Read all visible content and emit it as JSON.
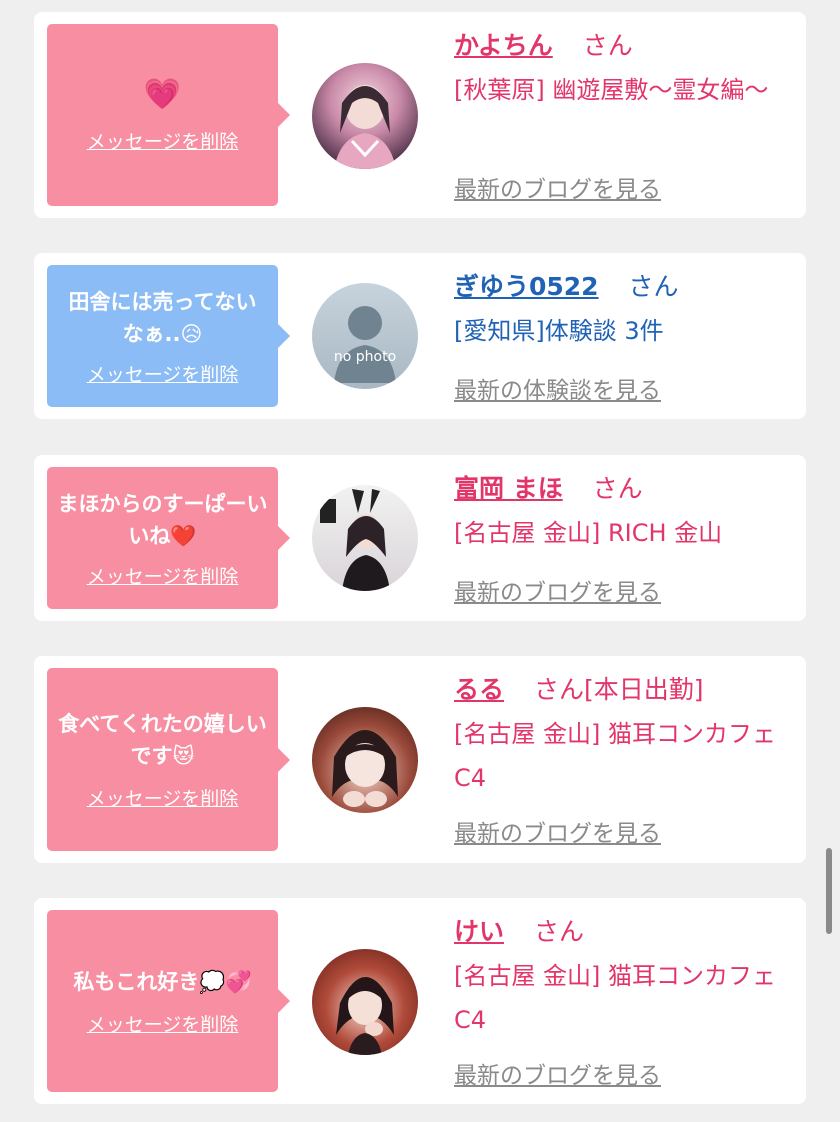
{
  "delete_label": "メッセージを削除",
  "honorific": "さん",
  "entries": [
    {
      "message": "💗",
      "name": "かよちん",
      "status": "",
      "shop": "[秋葉原] 幽遊屋敷～霊女編～",
      "more_link": "最新のブログを見る",
      "bubble_color": "#f88ea2",
      "name_color": "#e2366a"
    },
    {
      "message": "田舎には売ってないなぁ..😥",
      "name": "ぎゆう0522",
      "status": "",
      "shop": "[愛知県]体験談 3件",
      "more_link": "最新の体験談を見る",
      "avatar_text": "no photo",
      "bubble_color": "#8cbcf5",
      "name_color": "#2063b6"
    },
    {
      "message": "まほからのすーぱーいいね❤️",
      "name": "富岡 まほ",
      "status": "",
      "shop": "[名古屋 金山] RICH 金山",
      "more_link": "最新のブログを見る",
      "bubble_color": "#f88ea2",
      "name_color": "#e2366a"
    },
    {
      "message": "食べてくれたの嬉しいです😻",
      "name": "るる",
      "status": "[本日出勤]",
      "shop": "[名古屋 金山] 猫耳コンカフェ C4",
      "more_link": "最新のブログを見る",
      "bubble_color": "#f88ea2",
      "name_color": "#e2366a"
    },
    {
      "message": "私もこれ好き💭💞",
      "name": "けい",
      "status": "",
      "shop": "[名古屋 金山] 猫耳コンカフェ C4",
      "more_link": "最新のブログを見る",
      "bubble_color": "#f88ea2",
      "name_color": "#e2366a"
    }
  ]
}
